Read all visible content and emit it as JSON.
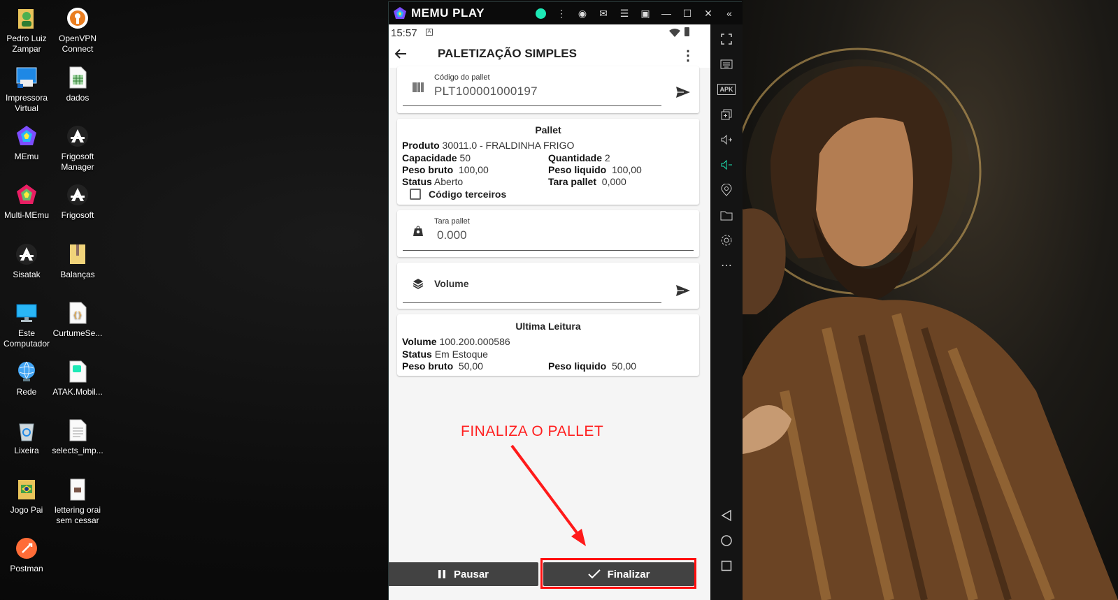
{
  "desktop": {
    "icons": [
      {
        "label": "Pedro Luiz Zampar"
      },
      {
        "label": "OpenVPN Connect"
      },
      {
        "label": "Impressora Virtual"
      },
      {
        "label": "dados"
      },
      {
        "label": "MEmu"
      },
      {
        "label": "Frigosoft Manager"
      },
      {
        "label": "Multi-MEmu"
      },
      {
        "label": "Frigosoft"
      },
      {
        "label": "Sisatak"
      },
      {
        "label": "Balanças"
      },
      {
        "label": "Este Computador"
      },
      {
        "label": "CurtumeSe..."
      },
      {
        "label": "Rede"
      },
      {
        "label": "ATAK.Mobil..."
      },
      {
        "label": "Lixeira"
      },
      {
        "label": "selects_imp..."
      },
      {
        "label": "Jogo Pai"
      },
      {
        "label": "lettering orai sem cessar"
      },
      {
        "label": "Postman"
      }
    ]
  },
  "emulator": {
    "brand": "MEMU PLAY",
    "accent": "#1de9b6",
    "status_time": "15:57",
    "app_title": "PALETIZAÇÃO SIMPLES",
    "pallet_code": {
      "label": "Código do pallet",
      "value": "PLT100001000197"
    },
    "pallet": {
      "heading": "Pallet",
      "produto_label": "Produto",
      "produto_value": "30011.0 - FRALDINHA  FRIGO",
      "capacidade_label": "Capacidade",
      "capacidade_value": "50",
      "quantidade_label": "Quantidade",
      "quantidade_value": "2",
      "peso_bruto_label": "Peso bruto",
      "peso_bruto_value": "100,00",
      "peso_liquido_label": "Peso liquido",
      "peso_liquido_value": "100,00",
      "status_label": "Status",
      "status_value": "Aberto",
      "tara_label": "Tara pallet",
      "tara_value": "0,000",
      "terceiros_label": "Código terceiros"
    },
    "tara_field": {
      "label": "Tara pallet",
      "value": "0.000"
    },
    "volume_field": {
      "placeholder": "Volume"
    },
    "ultima": {
      "heading": "Ultima Leitura",
      "volume_label": "Volume",
      "volume_value": "100.200.000586",
      "status_label": "Status",
      "status_value": "Em Estoque",
      "peso_bruto_label": "Peso bruto",
      "peso_bruto_value": "50,00",
      "peso_liquido_label": "Peso liquido",
      "peso_liquido_value": "50,00"
    },
    "buttons": {
      "pause": "Pausar",
      "finish": "Finalizar"
    }
  },
  "annotation": {
    "text": "FINALIZA O PALLET",
    "color": "#ff2020"
  }
}
